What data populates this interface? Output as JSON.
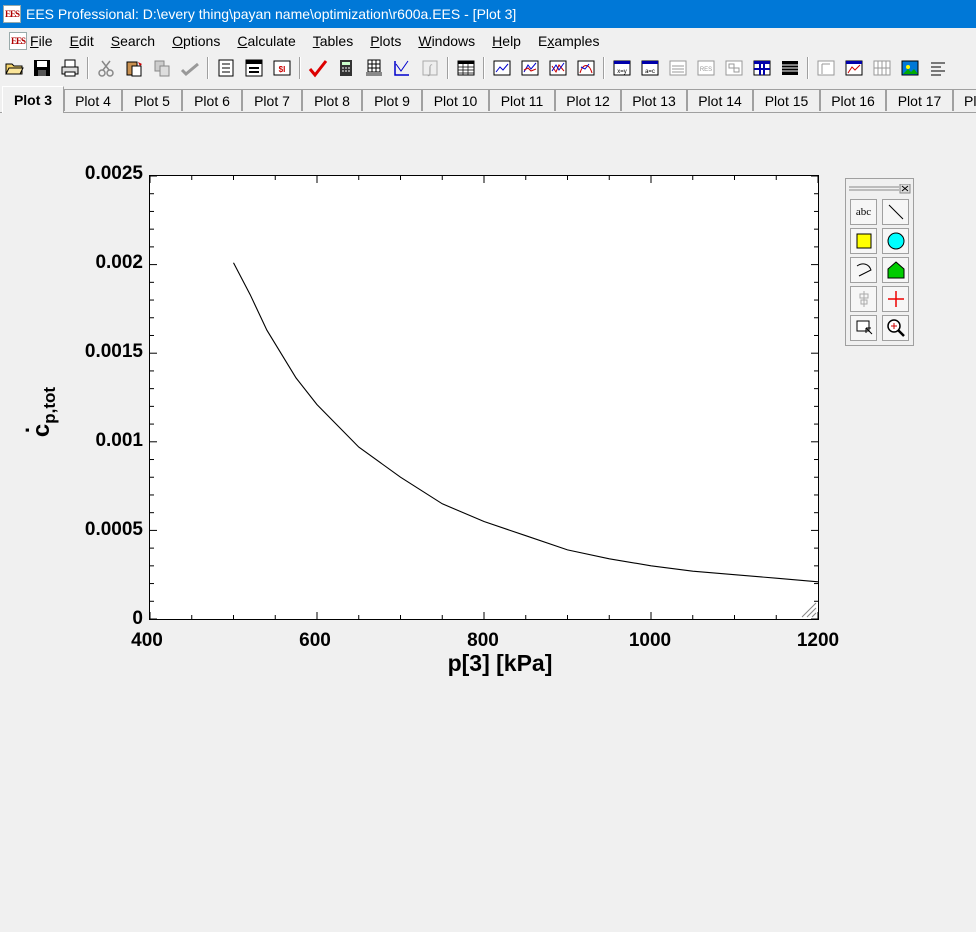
{
  "window": {
    "title": "EES Professional:  D:\\every thing\\payan name\\optimization\\r600a.EES - [Plot 3]",
    "app_icon_text": "EES"
  },
  "menu": [
    {
      "label": "File"
    },
    {
      "label": "Edit"
    },
    {
      "label": "Search"
    },
    {
      "label": "Options"
    },
    {
      "label": "Calculate"
    },
    {
      "label": "Tables"
    },
    {
      "label": "Plots"
    },
    {
      "label": "Windows"
    },
    {
      "label": "Help"
    },
    {
      "label": "Examples"
    }
  ],
  "tabs": [
    "Plot 3",
    "Plot 4",
    "Plot 5",
    "Plot 6",
    "Plot 7",
    "Plot 8",
    "Plot 9",
    "Plot 10",
    "Plot 11",
    "Plot 12",
    "Plot 13",
    "Plot 14",
    "Plot 15",
    "Plot 16",
    "Plot 17",
    "Pl"
  ],
  "active_tab": "Plot 3",
  "palette": {
    "text_tool_label": "abc"
  },
  "chart_data": {
    "type": "line",
    "xlabel": "p[3]  [kPa]",
    "ylabel": "c",
    "ylabel_subscript": "p,tot",
    "ylabel_dot": "·",
    "xlim": [
      400,
      1200
    ],
    "ylim": [
      0,
      0.0025
    ],
    "xticks": [
      "400",
      "600",
      "800",
      "1000",
      "1200"
    ],
    "yticks": [
      "0",
      "0.0005",
      "0.001",
      "0.0015",
      "0.002",
      "0.0025"
    ],
    "grid": false,
    "line_color": "#000000",
    "series": [
      {
        "x": [
          500,
          520,
          540,
          575,
          600,
          650,
          700,
          750,
          800,
          850,
          900,
          950,
          1000,
          1050,
          1100,
          1150,
          1200
        ],
        "y": [
          0.00201,
          0.00183,
          0.00163,
          0.00136,
          0.00121,
          0.00097,
          0.0008,
          0.00065,
          0.00055,
          0.00047,
          0.00039,
          0.00034,
          0.0003,
          0.00027,
          0.00025,
          0.00023,
          0.00021
        ]
      }
    ]
  }
}
